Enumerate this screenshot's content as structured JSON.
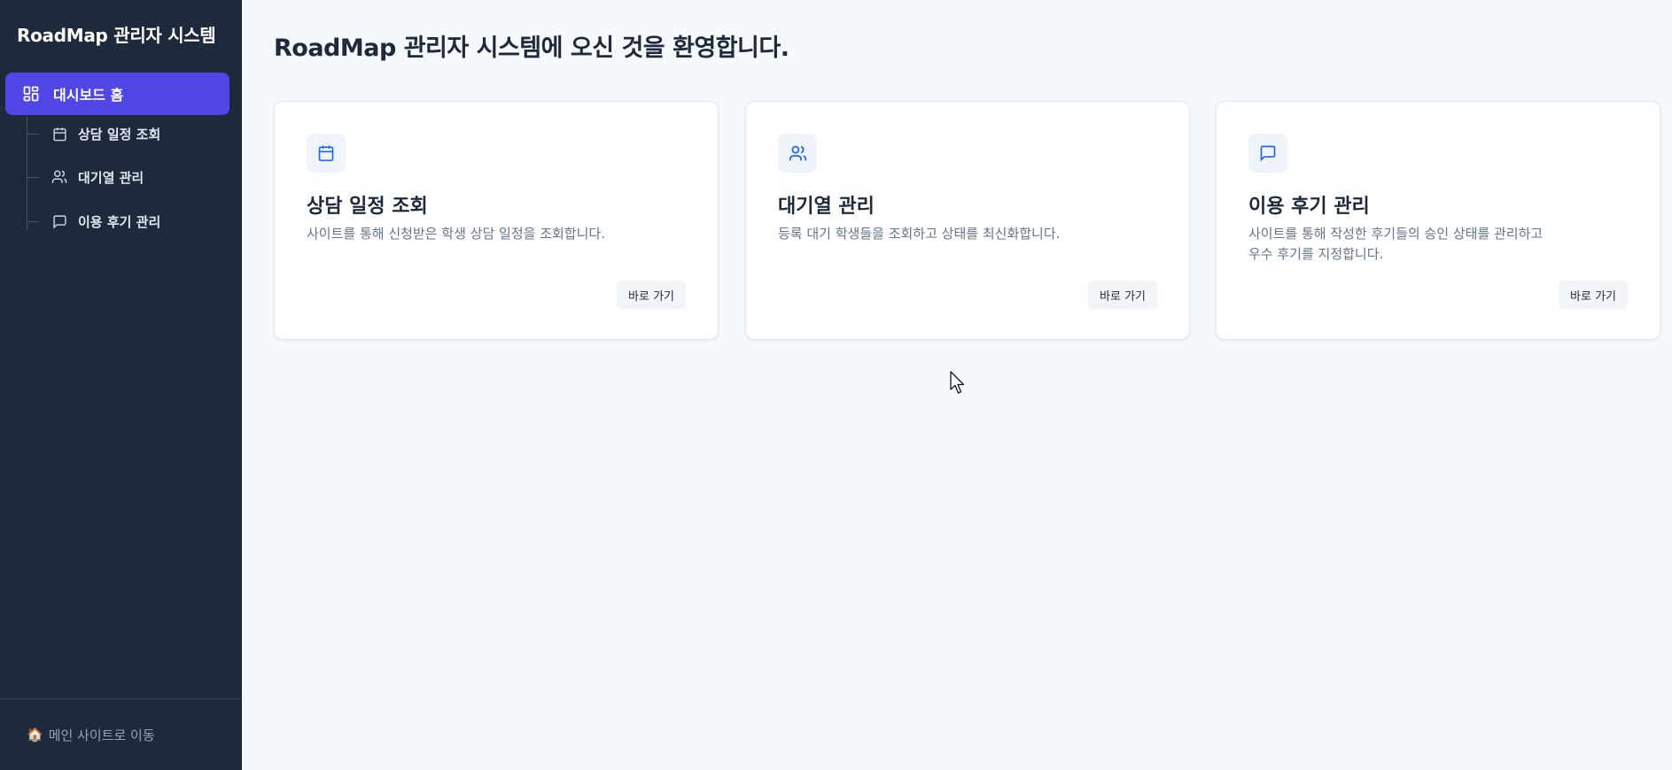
{
  "sidebar": {
    "brand": "RoadMap 관리자 시스템",
    "home": {
      "label": "대시보드 홈",
      "icon": "dashboard-grid-icon"
    },
    "items": [
      {
        "label": "상담 일정 조회",
        "icon": "calendar-icon"
      },
      {
        "label": "대기열 관리",
        "icon": "users-icon"
      },
      {
        "label": "이용 후기 관리",
        "icon": "message-square-icon"
      }
    ],
    "footer": {
      "icon_glyph": "🏠",
      "icon": "house-icon",
      "label": "메인 사이트로 이동"
    }
  },
  "main": {
    "title": "RoadMap 관리자 시스템에 오신 것을 환영합니다.",
    "cards": [
      {
        "icon": "calendar-icon",
        "title": "상담 일정 조회",
        "desc_lines": [
          "사이트를 통해 신청받은 학생 상담 일정을 조회합니다."
        ],
        "button": "바로 가기"
      },
      {
        "icon": "users-icon",
        "title": "대기열 관리",
        "desc_lines": [
          "등록 대기 학생들을 조회하고 상태를 최신화합니다."
        ],
        "button": "바로 가기"
      },
      {
        "icon": "message-square-icon",
        "title": "이용 후기 관리",
        "desc_lines": [
          "사이트를 통해 작성한 후기들의 승인 상태를 관리하고",
          "우수 후기를 지정합니다."
        ],
        "button": "바로 가기"
      }
    ]
  },
  "colors": {
    "sidebar_bg": "#1e293b",
    "accent": "#4f46e5",
    "main_bg": "#f6f9fc",
    "icon_accent": "#2563eb"
  }
}
